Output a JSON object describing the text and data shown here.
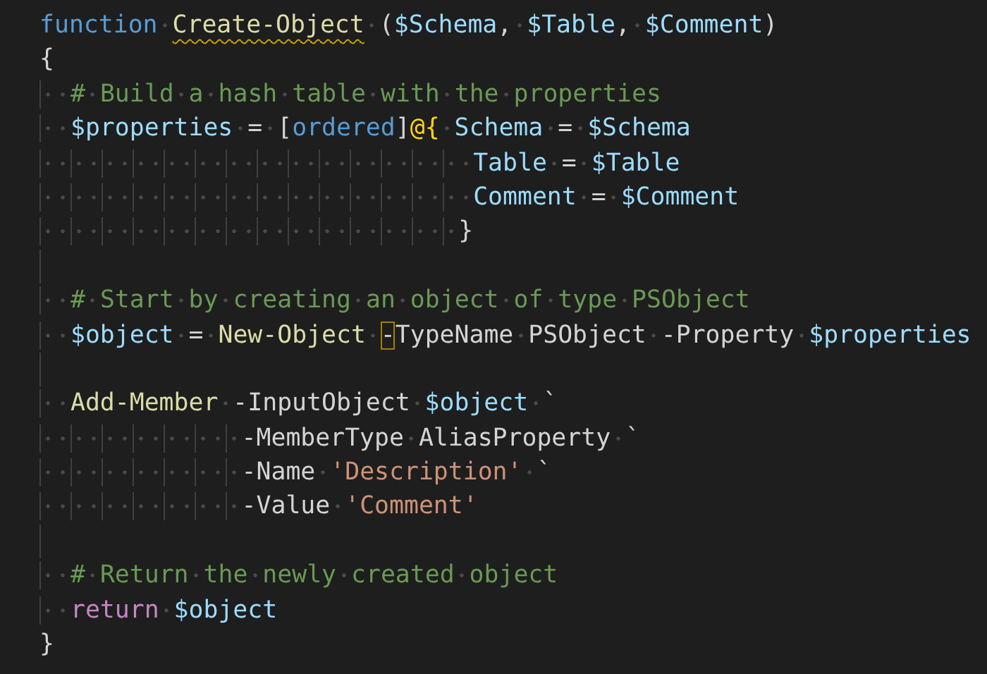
{
  "editor": {
    "lines": [
      {
        "kind": "code",
        "tokens": [
          {
            "text": "function",
            "kind": "keyword"
          },
          {
            "text": " Create-Object",
            "kind": "function",
            "warning": true
          },
          {
            "text": " (",
            "kind": "plain"
          },
          {
            "text": "$Schema",
            "kind": "variable"
          },
          {
            "text": ", ",
            "kind": "plain"
          },
          {
            "text": "$Table",
            "kind": "variable"
          },
          {
            "text": ", ",
            "kind": "plain"
          },
          {
            "text": "$Comment",
            "kind": "variable"
          },
          {
            "text": ")",
            "kind": "plain"
          }
        ]
      },
      {
        "kind": "code",
        "tokens": [
          {
            "text": "{",
            "kind": "plain"
          }
        ]
      },
      {
        "kind": "code",
        "tokens": [
          {
            "text": "  # Build a hash table with the properties",
            "kind": "comment"
          }
        ]
      },
      {
        "kind": "code",
        "tokens": [
          {
            "text": "  $properties",
            "kind": "variable"
          },
          {
            "text": " = [",
            "kind": "plain"
          },
          {
            "text": "ordered",
            "kind": "keyword"
          },
          {
            "text": "]",
            "kind": "plain"
          },
          {
            "text": "@{",
            "kind": "brace"
          },
          {
            "text": " Schema",
            "kind": "variable"
          },
          {
            "text": " = ",
            "kind": "plain"
          },
          {
            "text": "$Schema",
            "kind": "variable"
          }
        ]
      },
      {
        "kind": "code",
        "tokens": [
          {
            "text": "                            Table",
            "kind": "variable"
          },
          {
            "text": " = ",
            "kind": "plain"
          },
          {
            "text": "$Table",
            "kind": "variable"
          }
        ]
      },
      {
        "kind": "code",
        "tokens": [
          {
            "text": "                            Comment",
            "kind": "variable"
          },
          {
            "text": " = ",
            "kind": "plain"
          },
          {
            "text": "$Comment",
            "kind": "variable"
          }
        ]
      },
      {
        "kind": "code",
        "tokens": [
          {
            "text": "                           }",
            "kind": "plain"
          }
        ]
      },
      {
        "kind": "blank"
      },
      {
        "kind": "code",
        "tokens": [
          {
            "text": "  # Start by creating an object of type PSObject",
            "kind": "comment"
          }
        ]
      },
      {
        "kind": "code",
        "tokens": [
          {
            "text": "  $object",
            "kind": "variable"
          },
          {
            "text": " = ",
            "kind": "plain"
          },
          {
            "text": "New-Object",
            "kind": "function"
          },
          {
            "text": " -",
            "kind": "plain",
            "highlight": true
          },
          {
            "text": "TypeName PSObject -Property ",
            "kind": "plain"
          },
          {
            "text": "$properties",
            "kind": "variable"
          }
        ]
      },
      {
        "kind": "blank"
      },
      {
        "kind": "code",
        "tokens": [
          {
            "text": "  Add-Member",
            "kind": "function"
          },
          {
            "text": " -InputObject ",
            "kind": "plain"
          },
          {
            "text": "$object",
            "kind": "variable"
          },
          {
            "text": " `",
            "kind": "plain"
          }
        ]
      },
      {
        "kind": "code",
        "tokens": [
          {
            "text": "             -MemberType AliasProperty `",
            "kind": "plain"
          }
        ]
      },
      {
        "kind": "code",
        "tokens": [
          {
            "text": "             -Name ",
            "kind": "plain"
          },
          {
            "text": "'Description'",
            "kind": "string"
          },
          {
            "text": " `",
            "kind": "plain"
          }
        ]
      },
      {
        "kind": "code",
        "tokens": [
          {
            "text": "             -Value ",
            "kind": "plain"
          },
          {
            "text": "'Comment'",
            "kind": "string"
          }
        ]
      },
      {
        "kind": "blank"
      },
      {
        "kind": "code",
        "tokens": [
          {
            "text": "  # Return the newly created object",
            "kind": "comment"
          }
        ]
      },
      {
        "kind": "code",
        "tokens": [
          {
            "text": "  return",
            "kind": "control"
          },
          {
            "text": " $object",
            "kind": "variable"
          }
        ]
      },
      {
        "kind": "code",
        "tokens": [
          {
            "text": "}",
            "kind": "plain"
          }
        ]
      }
    ]
  }
}
